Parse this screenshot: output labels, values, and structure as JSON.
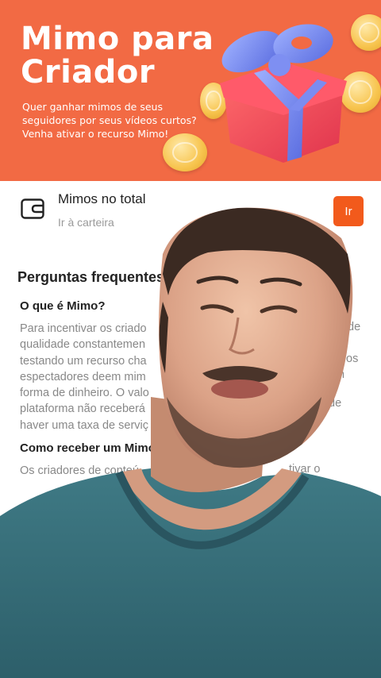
{
  "banner": {
    "title_line1": "Mimo para",
    "title_line2": "Criador",
    "subtitle": "Quer ganhar mimos de seus seguidores por seus vídeos curtos? Venha ativar o recurso Mimo!",
    "color": "#f26a44"
  },
  "wallet": {
    "title": "Mimos no total",
    "link": "Ir à carteira",
    "button": "Ir",
    "button_color": "#f25a1c"
  },
  "faq": {
    "title": "Perguntas frequentes",
    "items": [
      {
        "question": "O que é Mimo?",
        "answer_lines": [
          "Para incentivar os criado",
          "qualidade constantemen",
          "testando um recurso cha",
          "espectadores deem mim",
          "forma de dinheiro. O valo",
          "plataforma não receberá",
          "haver uma taxa de serviç"
        ],
        "answer_fragments_right": [
          "de",
          "os",
          "n",
          "de"
        ]
      },
      {
        "question": "Como receber um Mimo",
        "answer_lines": [
          "Os criadores de conteú"
        ],
        "answer_fragments_right": [
          "tivar o"
        ]
      }
    ]
  }
}
